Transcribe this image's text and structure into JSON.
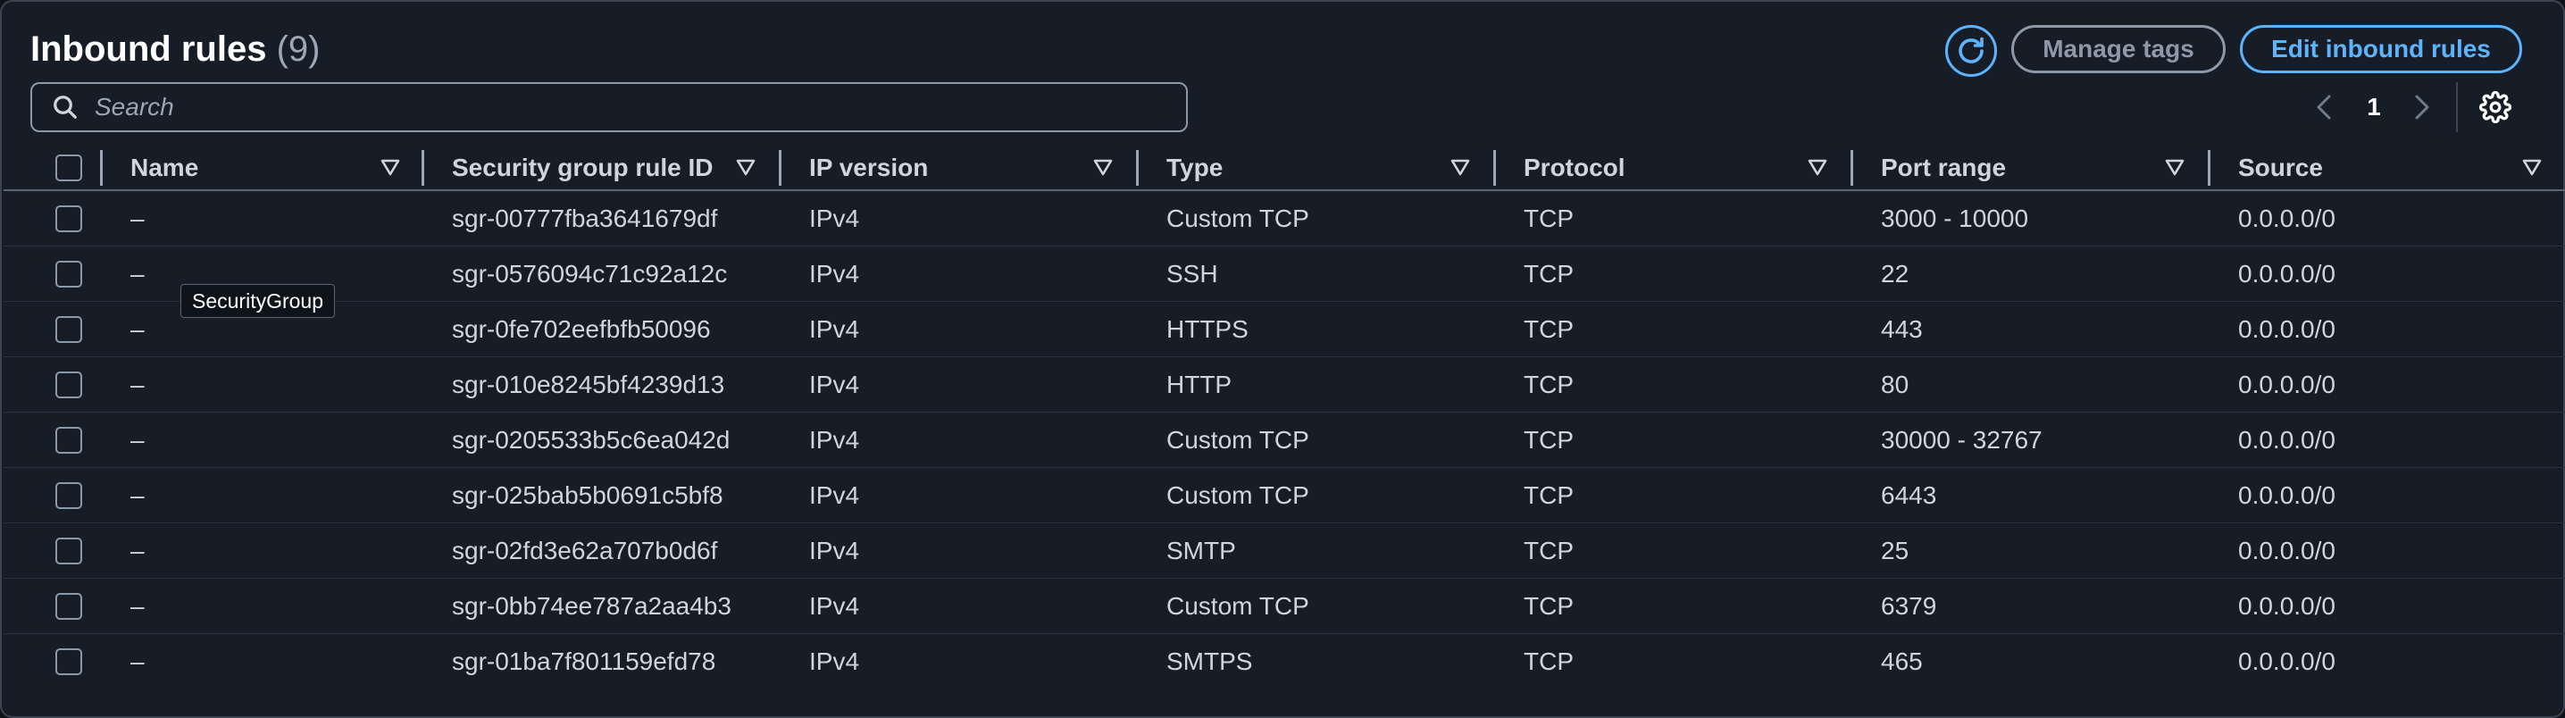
{
  "header": {
    "title": "Inbound rules",
    "count": "(9)",
    "manage_tags_label": "Manage tags",
    "edit_inbound_label": "Edit inbound rules",
    "refresh_icon": "refresh-icon",
    "accent_color": "#5cb4ff"
  },
  "search": {
    "placeholder": "Search",
    "value": ""
  },
  "pagination": {
    "current_page": "1",
    "prev_icon": "chevron-left-icon",
    "next_icon": "chevron-right-icon",
    "settings_icon": "gear-icon"
  },
  "table": {
    "columns": [
      {
        "label": "Name"
      },
      {
        "label": "Security group rule ID"
      },
      {
        "label": "IP version"
      },
      {
        "label": "Type"
      },
      {
        "label": "Protocol"
      },
      {
        "label": "Port range"
      },
      {
        "label": "Source"
      }
    ],
    "rows": [
      {
        "name": "–",
        "rule_id": "sgr-00777fba3641679df",
        "ip_version": "IPv4",
        "type": "Custom TCP",
        "protocol": "TCP",
        "port_range": "3000 - 10000",
        "source": "0.0.0.0/0"
      },
      {
        "name": "–",
        "rule_id": "sgr-0576094c71c92a12c",
        "ip_version": "IPv4",
        "type": "SSH",
        "protocol": "TCP",
        "port_range": "22",
        "source": "0.0.0.0/0"
      },
      {
        "name": "–",
        "rule_id": "sgr-0fe702eefbfb50096",
        "ip_version": "IPv4",
        "type": "HTTPS",
        "protocol": "TCP",
        "port_range": "443",
        "source": "0.0.0.0/0"
      },
      {
        "name": "–",
        "rule_id": "sgr-010e8245bf4239d13",
        "ip_version": "IPv4",
        "type": "HTTP",
        "protocol": "TCP",
        "port_range": "80",
        "source": "0.0.0.0/0"
      },
      {
        "name": "–",
        "rule_id": "sgr-0205533b5c6ea042d",
        "ip_version": "IPv4",
        "type": "Custom TCP",
        "protocol": "TCP",
        "port_range": "30000 - 32767",
        "source": "0.0.0.0/0"
      },
      {
        "name": "–",
        "rule_id": "sgr-025bab5b0691c5bf8",
        "ip_version": "IPv4",
        "type": "Custom TCP",
        "protocol": "TCP",
        "port_range": "6443",
        "source": "0.0.0.0/0"
      },
      {
        "name": "–",
        "rule_id": "sgr-02fd3e62a707b0d6f",
        "ip_version": "IPv4",
        "type": "SMTP",
        "protocol": "TCP",
        "port_range": "25",
        "source": "0.0.0.0/0"
      },
      {
        "name": "–",
        "rule_id": "sgr-0bb74ee787a2aa4b3",
        "ip_version": "IPv4",
        "type": "Custom TCP",
        "protocol": "TCP",
        "port_range": "6379",
        "source": "0.0.0.0/0"
      },
      {
        "name": "–",
        "rule_id": "sgr-01ba7f801159efd78",
        "ip_version": "IPv4",
        "type": "SMTPS",
        "protocol": "TCP",
        "port_range": "465",
        "source": "0.0.0.0/0"
      }
    ]
  },
  "tooltip": {
    "text": "SecurityGroup"
  }
}
